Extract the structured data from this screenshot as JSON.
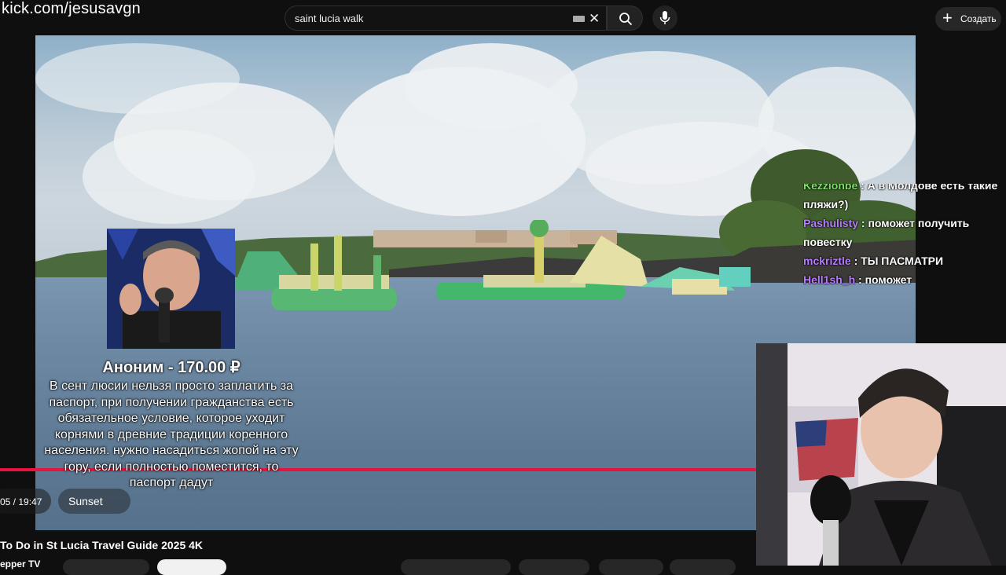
{
  "overlay": {
    "stream_url": "kick.com/jesusavgn"
  },
  "header": {
    "search_value": "saint lucia walk",
    "create_label": "Создать"
  },
  "player": {
    "time_display": "05 / 19:47",
    "chapter_label": "Sunset",
    "progress_fraction": 1.0
  },
  "donation": {
    "title": "Аноним - 170.00 ₽",
    "message": "В сент люсии нельзя просто заплатить за паспорт, при получении гражданства есть обязательное условие, которое уходит корнями в древние традиции коренного населения. нужно насадиться жопой на эту гору, если полностью поместится, то паспорт дадут"
  },
  "chat": {
    "messages": [
      {
        "user": "Kezzlonbe",
        "text": ": А в Молдове есть такие пляжи?)"
      },
      {
        "user": "Pashulisty",
        "text": ": поможет получить повестку"
      },
      {
        "user": "mckriztle",
        "text": ": ТЫ ПАСМАТРИ"
      },
      {
        "user": "Hell1sh_h",
        "text": ": поможет"
      }
    ]
  },
  "below_video": {
    "title": "To Do in St Lucia Travel Guide 2025 4K",
    "channel": "epper TV"
  },
  "colors": {
    "progress": "#e8143f",
    "chat_user": "#b87cff",
    "background": "#0f0f0f"
  }
}
